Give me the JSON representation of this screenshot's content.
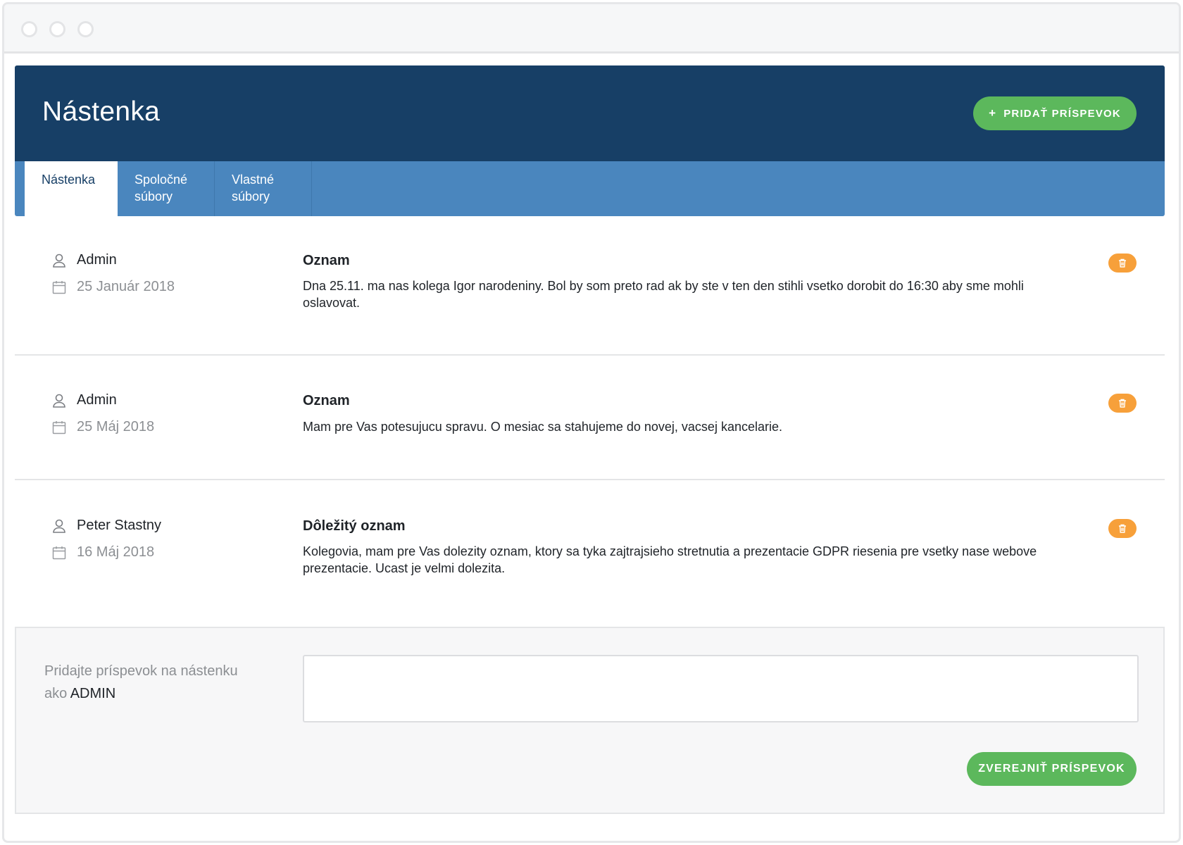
{
  "header": {
    "title": "Nástenka",
    "add_post_label": "PRIDAŤ PRÍSPEVOK"
  },
  "tabs": [
    {
      "label": "Nástenka",
      "active": true
    },
    {
      "label": "Spoločné súbory",
      "active": false
    },
    {
      "label": "Vlastné súbory",
      "active": false
    }
  ],
  "posts": [
    {
      "author": "Admin",
      "date": "25 Január 2018",
      "title": "Oznam",
      "body": "Dna 25.11. ma nas kolega Igor narodeniny. Bol by som preto rad ak by ste v ten den stihli vsetko dorobit do 16:30 aby sme mohli oslavovat."
    },
    {
      "author": "Admin",
      "date": "25 Máj 2018",
      "title": "Oznam",
      "body": "Mam pre Vas potesujucu spravu. O mesiac sa stahujeme do novej, vacsej kancelarie."
    },
    {
      "author": "Peter Stastny",
      "date": "16 Máj 2018",
      "title": "Dôležitý oznam",
      "body": "Kolegovia, mam pre Vas dolezity oznam, ktory sa tyka zajtrajsieho stretnutia a prezentacie GDPR riesenia pre vsetky nase webove prezentacie. Ucast je velmi dolezita."
    }
  ],
  "composer": {
    "label_prefix": "Pridajte príspevok na nástenku ako",
    "username": "ADMIN",
    "input_value": "",
    "publish_label": "ZVEREJNIŤ PRÍSPEVOK"
  },
  "colors": {
    "header_bg": "#173f66",
    "tabs_bg": "#4a86be",
    "success": "#5cb85c",
    "delete": "#f7a03a"
  },
  "icons": {
    "author": "user-icon",
    "date": "calendar-icon",
    "delete": "trash-icon",
    "add": "plus-icon"
  }
}
